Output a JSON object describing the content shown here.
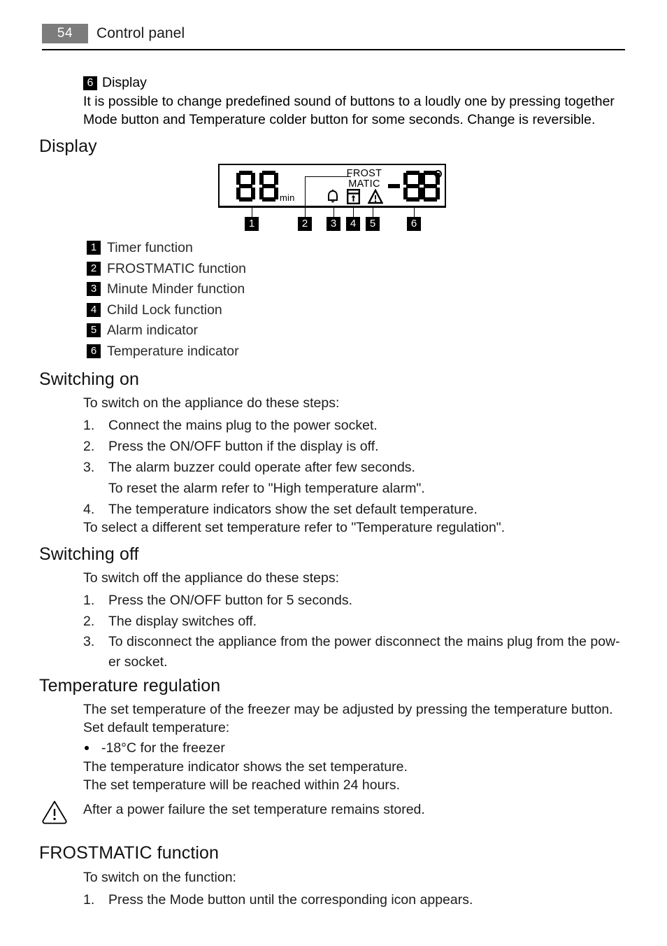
{
  "header": {
    "page_number": "54",
    "title": "Control panel",
    "page_number_bg": "#7c7c7c"
  },
  "intro": {
    "chip": "6",
    "chip_label": "Display",
    "paragraph": "It is possible to change predefined sound of buttons to a loudly one by pressing together Mode button and Temperature colder button for some seconds. Change is reversible."
  },
  "display_section": {
    "heading": "Display",
    "lcd": {
      "timer_digits": "88",
      "timer_unit": "min",
      "frostmatic_line1": "FROST",
      "frostmatic_line2": "MATIC",
      "temperature_sign": "-",
      "temperature_digits": "88",
      "degree_symbol": "°",
      "icons": [
        "bell-icon",
        "child-lock-icon",
        "alarm-triangle-icon"
      ]
    },
    "callouts": [
      "1",
      "2",
      "3",
      "4",
      "5",
      "6"
    ],
    "legend": [
      {
        "num": "1",
        "label": "Timer function"
      },
      {
        "num": "2",
        "label": "FROSTMATIC function"
      },
      {
        "num": "3",
        "label": "Minute Minder function"
      },
      {
        "num": "4",
        "label": "Child Lock function"
      },
      {
        "num": "5",
        "label": "Alarm indicator"
      },
      {
        "num": "6",
        "label": "Temperature indicator"
      }
    ]
  },
  "switching_on": {
    "heading": "Switching on",
    "intro": "To switch on the appliance do these steps:",
    "steps": [
      {
        "n": "1.",
        "text": "Connect the mains plug to the power socket."
      },
      {
        "n": "2.",
        "text": "Press the ON/OFF button if the display is off."
      },
      {
        "n": "3.",
        "text": "The alarm buzzer could operate after few seconds."
      }
    ],
    "substep": "To reset the alarm refer to \"High temperature alarm\".",
    "step4": {
      "n": "4.",
      "text": "The temperature indicators show the set default temperature."
    },
    "closing": "To select a different set temperature refer to \"Temperature regulation\"."
  },
  "switching_off": {
    "heading": "Switching off",
    "intro": "To switch off the appliance do these steps:",
    "steps": [
      {
        "n": "1.",
        "text": "Press the ON/OFF button for 5 seconds."
      },
      {
        "n": "2.",
        "text": "The display switches off."
      },
      {
        "n": "3.",
        "text": "To disconnect the appliance from the power disconnect the mains plug from the pow-er socket."
      }
    ]
  },
  "temperature_regulation": {
    "heading": "Temperature regulation",
    "line1": "The set temperature of the freezer may be adjusted by pressing the temperature button.",
    "line2": "Set default temperature:",
    "bullet": "-18°C for the freezer",
    "line3": "The temperature indicator shows the set temperature.",
    "line4": "The set temperature will be reached within 24 hours."
  },
  "note": {
    "icon": "warning-triangle-icon",
    "text": "After a power failure the set temperature remains stored."
  },
  "frostmatic_function": {
    "heading": "FROSTMATIC function",
    "intro": "To switch on the function:",
    "steps": [
      {
        "n": "1.",
        "text": "Press the Mode button until the corresponding icon appears."
      }
    ]
  }
}
